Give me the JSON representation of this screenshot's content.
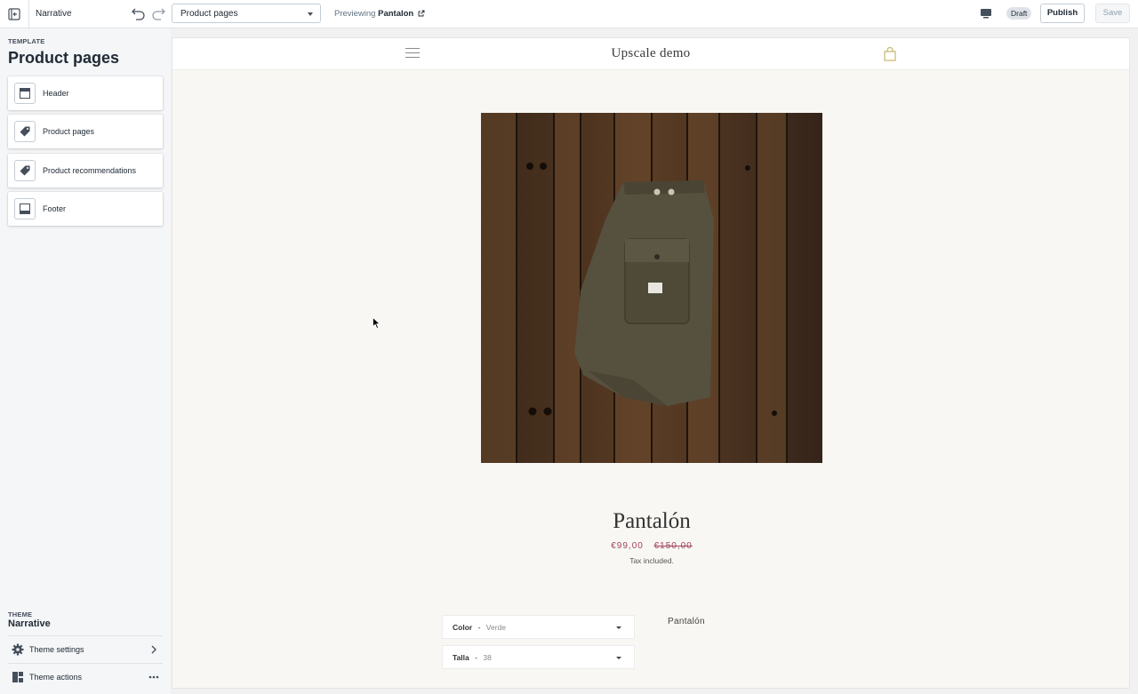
{
  "topbar": {
    "theme_name": "Narrative",
    "template_select": "Product pages",
    "previewing_label": "Previewing",
    "previewing_product": "Pantalon",
    "status_badge": "Draft",
    "publish_label": "Publish",
    "save_label": "Save"
  },
  "sidebar": {
    "template_label": "TEMPLATE",
    "template_title": "Product pages",
    "sections": [
      {
        "label": "Header",
        "icon": "header-layout-icon"
      },
      {
        "label": "Product pages",
        "icon": "tag-icon"
      },
      {
        "label": "Product recommendations",
        "icon": "tag-icon"
      },
      {
        "label": "Footer",
        "icon": "footer-layout-icon"
      }
    ],
    "theme_label": "THEME",
    "theme_name": "Narrative",
    "theme_settings_label": "Theme settings",
    "theme_actions_label": "Theme actions"
  },
  "preview": {
    "store_name": "Upscale demo",
    "product_title": "Pantalón",
    "price": "€99,00",
    "compare_price": "€150,00",
    "tax_note": "Tax included.",
    "options": [
      {
        "name": "Color",
        "value": "Verde"
      },
      {
        "name": "Talla",
        "value": "38"
      }
    ],
    "side_product_name": "Pantalón"
  },
  "colors": {
    "accent_price": "#a0435a",
    "preview_background": "#f8f7f3",
    "sidebar_background": "#f4f6f8"
  }
}
